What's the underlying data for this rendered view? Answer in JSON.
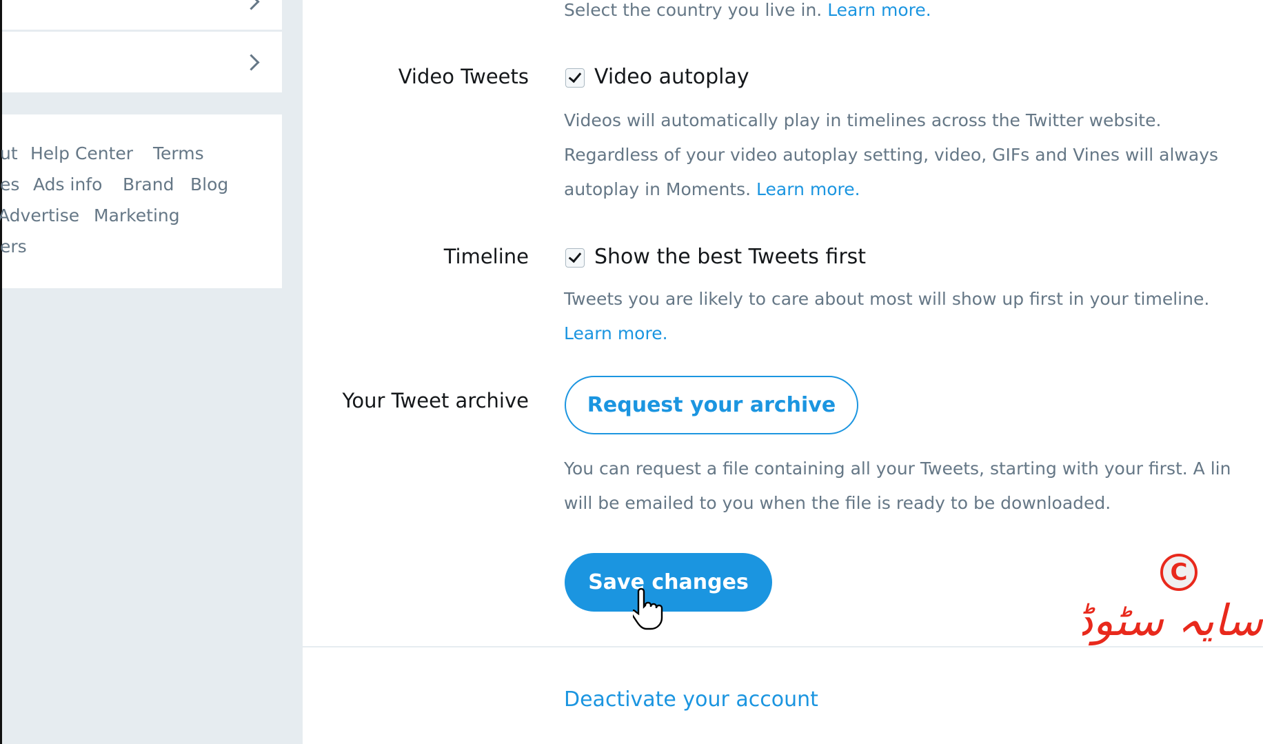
{
  "sidebar": {
    "footer_links": [
      [
        "ut",
        "Help Center",
        "Terms"
      ],
      [
        "es",
        "Ads info",
        "Brand",
        "Blog"
      ],
      [
        "Advertise",
        "Marketing"
      ],
      [
        "ers"
      ]
    ]
  },
  "main": {
    "country_desc": "Select the country you live in.",
    "country_learn_more": "Learn more.",
    "video": {
      "label": "Video Tweets",
      "checkbox_label": "Video autoplay",
      "checked": true,
      "desc_lines": [
        "Videos will automatically play in timelines across the Twitter website.",
        "Regardless of your video autoplay setting, video, GIFs and Vines will always",
        "autoplay in Moments."
      ],
      "learn_more": "Learn more."
    },
    "timeline": {
      "label": "Timeline",
      "checkbox_label": "Show the best Tweets first",
      "checked": true,
      "desc_lines": [
        "Tweets you are likely to care about most will show up first in your timeline."
      ],
      "learn_more": "Learn more."
    },
    "archive": {
      "label": "Your Tweet archive",
      "button": "Request your archive",
      "desc_lines": [
        "You can request a file containing all your Tweets, starting with your first. A lin",
        "will be emailed to you when the file is ready to be downloaded."
      ]
    },
    "save_button": "Save changes",
    "deactivate_link": "Deactivate your account"
  },
  "watermark": {
    "symbol": "©",
    "text": "سایہ سٹوڈیو"
  },
  "colors": {
    "accent": "#1b95e0",
    "muted": "#657786",
    "background": "#e6ecf0",
    "watermark": "#e8291c"
  }
}
